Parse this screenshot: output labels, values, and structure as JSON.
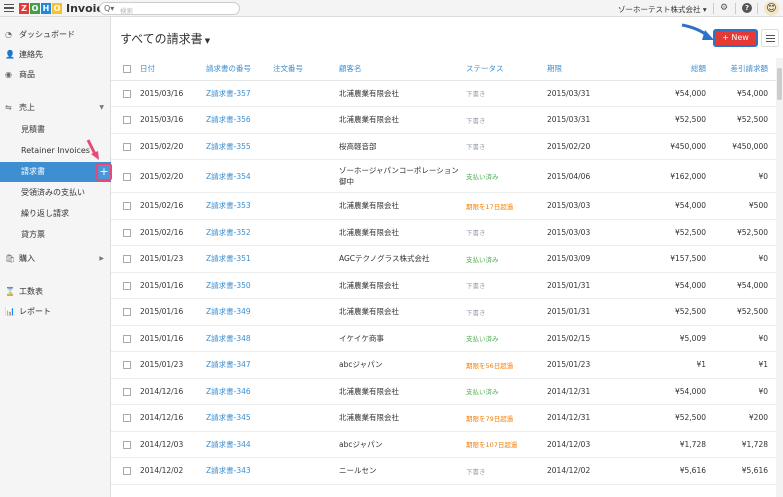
{
  "topbar": {
    "brand_tiles": [
      "Z",
      "O",
      "H",
      "O"
    ],
    "brand": "Invoice",
    "search_scope": "Q▾",
    "search_placeholder": "検索",
    "org_name": "ゾーホーテスト株式会社 ▾"
  },
  "sidebar": {
    "items": [
      {
        "label": "ダッシュボード",
        "icon": "dashboard-icon",
        "glyph": "◔"
      },
      {
        "label": "連絡先",
        "icon": "contacts-icon",
        "glyph": "👤"
      },
      {
        "label": "商品",
        "icon": "items-icon",
        "glyph": "◉"
      },
      {
        "label": "売上",
        "icon": "sales-icon",
        "glyph": "⇋",
        "expanded": true
      },
      {
        "label": "購入",
        "icon": "purchases-icon",
        "glyph": "🛍"
      },
      {
        "label": "工数表",
        "icon": "timesheet-icon",
        "glyph": "⌛"
      },
      {
        "label": "レポート",
        "icon": "reports-icon",
        "glyph": "📊"
      }
    ],
    "sub_items": [
      {
        "label": "見積書"
      },
      {
        "label": "Retainer Invoices"
      },
      {
        "label": "請求書",
        "active": true
      },
      {
        "label": "受領済みの支払い"
      },
      {
        "label": "繰り返し請求"
      },
      {
        "label": "貸方票"
      }
    ],
    "plus_label": "+"
  },
  "main": {
    "title": "すべての請求書",
    "new_button": "+ New"
  },
  "table": {
    "columns": [
      "日付",
      "請求書の番号",
      "注文番号",
      "顧客名",
      "ステータス",
      "期限",
      "総額",
      "差引請求額"
    ],
    "rows": [
      {
        "date": "2015/03/16",
        "number": "Z請求書-357",
        "order": "",
        "customer": "北浦農業有限会社",
        "status": "下書き",
        "status_color": "gray",
        "due": "2015/03/31",
        "total": "¥54,000",
        "balance": "¥54,000"
      },
      {
        "date": "2015/03/16",
        "number": "Z請求書-356",
        "order": "",
        "customer": "北浦農業有限会社",
        "status": "下書き",
        "status_color": "gray",
        "due": "2015/03/31",
        "total": "¥52,500",
        "balance": "¥52,500"
      },
      {
        "date": "2015/02/20",
        "number": "Z請求書-355",
        "order": "",
        "customer": "桜高軽音部",
        "status": "下書き",
        "status_color": "gray",
        "due": "2015/02/20",
        "total": "¥450,000",
        "balance": "¥450,000"
      },
      {
        "date": "2015/02/20",
        "number": "Z請求書-354",
        "order": "",
        "customer": "ゾーホージャパンコーポレーション御中",
        "status": "支払い済み",
        "status_color": "green",
        "due": "2015/04/06",
        "total": "¥162,000",
        "balance": "¥0"
      },
      {
        "date": "2015/02/16",
        "number": "Z請求書-353",
        "order": "",
        "customer": "北浦農業有限会社",
        "status": "期限を17日超過",
        "status_color": "orange",
        "due": "2015/03/03",
        "total": "¥54,000",
        "balance": "¥500"
      },
      {
        "date": "2015/02/16",
        "number": "Z請求書-352",
        "order": "",
        "customer": "北浦農業有限会社",
        "status": "下書き",
        "status_color": "gray",
        "due": "2015/03/03",
        "total": "¥52,500",
        "balance": "¥52,500"
      },
      {
        "date": "2015/01/23",
        "number": "Z請求書-351",
        "order": "",
        "customer": "AGCテクノグラス株式会社",
        "status": "支払い済み",
        "status_color": "green",
        "due": "2015/03/09",
        "total": "¥157,500",
        "balance": "¥0"
      },
      {
        "date": "2015/01/16",
        "number": "Z請求書-350",
        "order": "",
        "customer": "北浦農業有限会社",
        "status": "下書き",
        "status_color": "gray",
        "due": "2015/01/31",
        "total": "¥54,000",
        "balance": "¥54,000"
      },
      {
        "date": "2015/01/16",
        "number": "Z請求書-349",
        "order": "",
        "customer": "北浦農業有限会社",
        "status": "下書き",
        "status_color": "gray",
        "due": "2015/01/31",
        "total": "¥52,500",
        "balance": "¥52,500"
      },
      {
        "date": "2015/01/16",
        "number": "Z請求書-348",
        "order": "",
        "customer": "イケイケ商事",
        "status": "支払い済み",
        "status_color": "green",
        "due": "2015/02/15",
        "total": "¥5,009",
        "balance": "¥0"
      },
      {
        "date": "2015/01/23",
        "number": "Z請求書-347",
        "order": "",
        "customer": "abcジャパン",
        "status": "期限を56日超過",
        "status_color": "orange",
        "due": "2015/01/23",
        "total": "¥1",
        "balance": "¥1"
      },
      {
        "date": "2014/12/16",
        "number": "Z請求書-346",
        "order": "",
        "customer": "北浦農業有限会社",
        "status": "支払い済み",
        "status_color": "green",
        "due": "2014/12/31",
        "total": "¥54,000",
        "balance": "¥0"
      },
      {
        "date": "2014/12/16",
        "number": "Z請求書-345",
        "order": "",
        "customer": "北浦農業有限会社",
        "status": "期限を79日超過",
        "status_color": "orange",
        "due": "2014/12/31",
        "total": "¥52,500",
        "balance": "¥200"
      },
      {
        "date": "2014/12/03",
        "number": "Z請求書-344",
        "order": "",
        "customer": "abcジャパン",
        "status": "期限を107日超過",
        "status_color": "orange",
        "due": "2014/12/03",
        "total": "¥1,728",
        "balance": "¥1,728"
      },
      {
        "date": "2014/12/02",
        "number": "Z請求書-343",
        "order": "",
        "customer": "ニールセン",
        "status": "下書き",
        "status_color": "gray",
        "due": "2014/12/02",
        "total": "¥5,616",
        "balance": "¥5,616"
      }
    ]
  },
  "colors": {
    "accent": "#3d8fd1",
    "new_button": "#e53935",
    "annotation_arrow_pink": "#e64a75",
    "annotation_arrow_blue": "#2d72c9"
  }
}
